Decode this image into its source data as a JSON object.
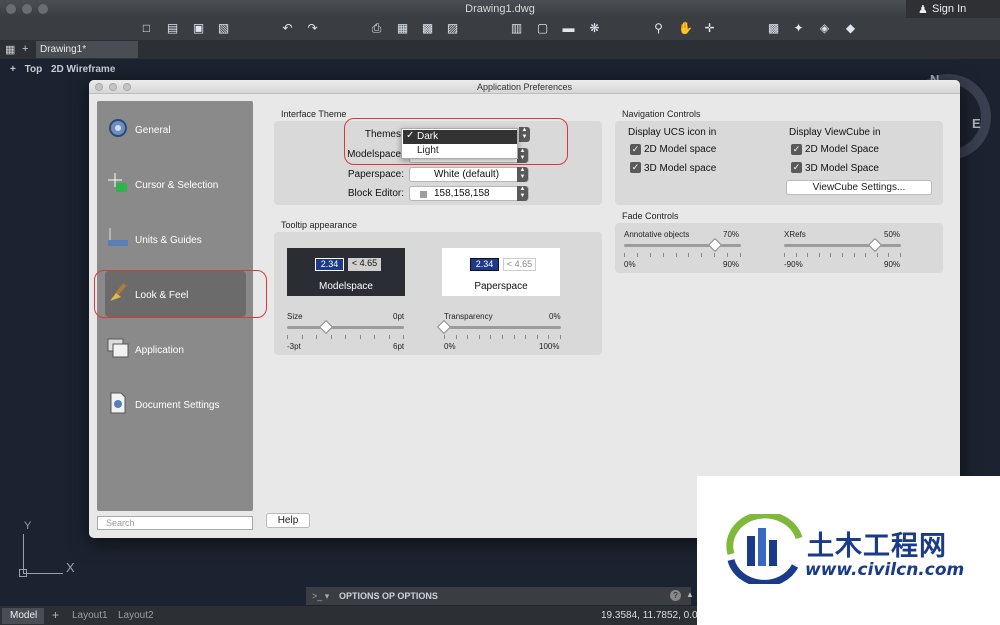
{
  "window": {
    "title": "Drawing1.dwg",
    "sign_in": "Sign In"
  },
  "doc_tab": {
    "label": "Drawing1*"
  },
  "view_label": {
    "view": "Top",
    "style": "2D Wireframe"
  },
  "compass": {
    "n": "N",
    "e": "E"
  },
  "ucs": {
    "y": "Y",
    "x": "X"
  },
  "command_line": {
    "prompt": ">_ ▾",
    "text": "OPTIONS OP OPTIONS",
    "help": "?"
  },
  "status_bar": {
    "model": "Model",
    "layouts": [
      "Layout1",
      "Layout2"
    ],
    "coords": "19.3584, 11.7852, 0.0"
  },
  "dialog": {
    "title": "Application Preferences",
    "sidebar": [
      {
        "label": "General",
        "icon": "gear-icon"
      },
      {
        "label": "Cursor & Selection",
        "icon": "cursor-icon"
      },
      {
        "label": "Units & Guides",
        "icon": "ruler-icon"
      },
      {
        "label": "Look & Feel",
        "icon": "brush-icon"
      },
      {
        "label": "Application",
        "icon": "windows-icon"
      },
      {
        "label": "Document Settings",
        "icon": "document-icon"
      }
    ],
    "search_placeholder": "Search",
    "help_button": "Help",
    "interface_theme": {
      "section": "Interface Theme",
      "themes_label": "Themes",
      "theme_options": [
        "Dark",
        "Light"
      ],
      "theme_selected": "Dark",
      "modelspace_label": "Modelspace",
      "paperspace_label": "Paperspace:",
      "paperspace_value": "White (default)",
      "block_editor_label": "Block Editor:",
      "block_editor_value": "158,158,158"
    },
    "tooltip": {
      "section": "Tooltip appearance",
      "model_card": {
        "n1": "2.34",
        "n2": "< 4.65",
        "caption": "Modelspace"
      },
      "paper_card": {
        "n1": "2.34",
        "n2": "< 4.65",
        "caption": "Paperspace"
      },
      "size": {
        "label": "Size",
        "value_label": "0pt",
        "min": "-3pt",
        "max": "6pt",
        "value": 0.33
      },
      "transparency": {
        "label": "Transparency",
        "value_label": "0%",
        "min": "0%",
        "max": "100%",
        "value": 0.0
      }
    },
    "navigation": {
      "section": "Navigation Controls",
      "ucs_header": "Display UCS icon in",
      "ucs_items": [
        "2D Model space",
        "3D Model space"
      ],
      "viewcube_header": "Display ViewCube in",
      "viewcube_items": [
        "2D Model Space",
        "3D Model Space"
      ],
      "viewcube_button": "ViewCube Settings..."
    },
    "fade": {
      "section": "Fade Controls",
      "annotative": {
        "label": "Annotative objects",
        "value_label": "70%",
        "min": "0%",
        "max": "90%",
        "value": 0.78
      },
      "xrefs": {
        "label": "XRefs",
        "value_label": "50%",
        "min": "-90%",
        "max": "90%",
        "value": 0.78
      }
    }
  },
  "watermark": {
    "text": "土木工程网",
    "url": "www.civilcn.com"
  },
  "colors": {
    "highlight": "#d83a3a",
    "sidebar": "#8a8a8a",
    "background": "#1c2330"
  }
}
